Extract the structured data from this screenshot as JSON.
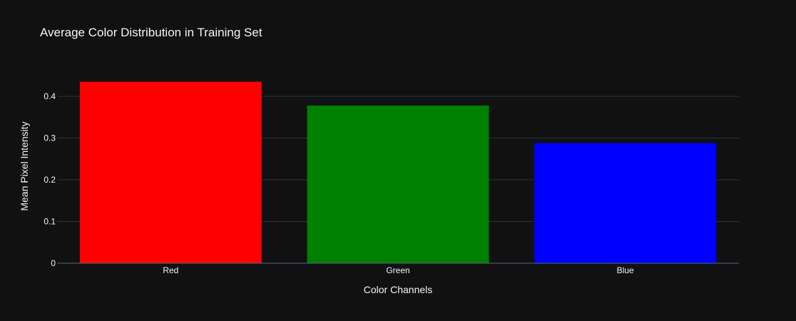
{
  "chart_data": {
    "type": "bar",
    "title": "Average Color Distribution in Training Set",
    "xlabel": "Color Channels",
    "ylabel": "Mean Pixel Intensity",
    "categories": [
      "Red",
      "Green",
      "Blue"
    ],
    "values": [
      0.435,
      0.378,
      0.288
    ],
    "bar_colors": [
      "#ff0000",
      "#008000",
      "#0000ff"
    ],
    "ylim": [
      0,
      0.46
    ],
    "yticks": [
      0,
      0.1,
      0.2,
      0.3,
      0.4
    ],
    "ytick_labels": [
      "0",
      "0.1",
      "0.2",
      "0.3",
      "0.4"
    ],
    "grid": true,
    "legend": false
  },
  "theme": {
    "background": "#111111",
    "text_color": "#f2f5fa",
    "grid_color": "#283442",
    "zero_line_color": "#506784"
  }
}
